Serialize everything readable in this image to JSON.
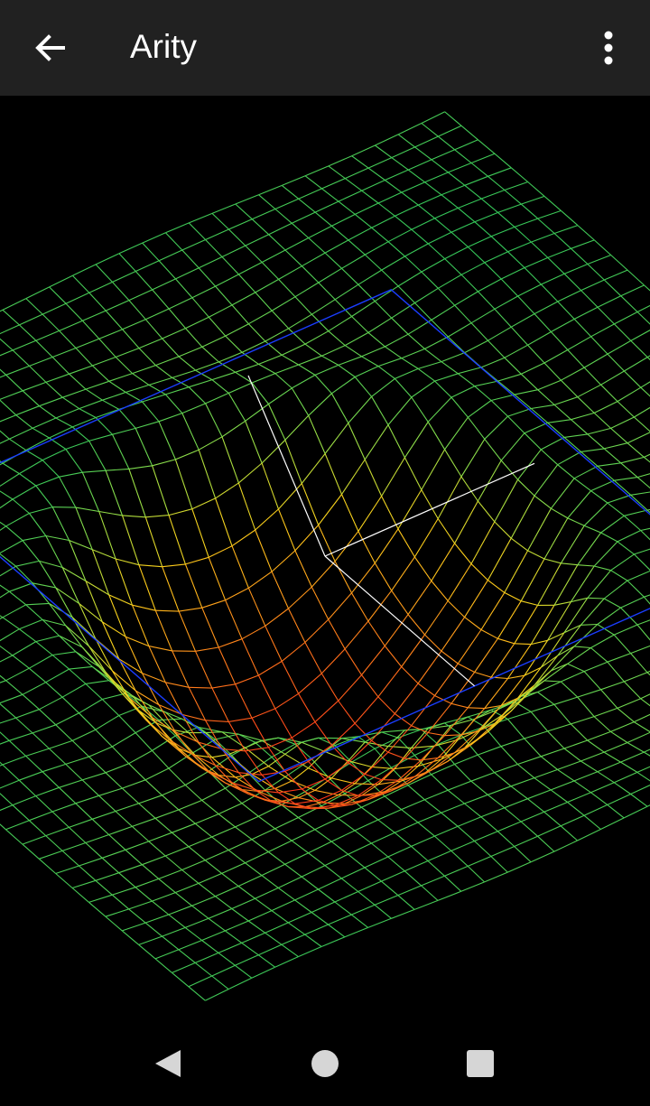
{
  "app": {
    "title": "Arity"
  },
  "toolbar": {
    "back_icon": "arrow-left-icon",
    "overflow_icon": "more-vert-icon"
  },
  "graph": {
    "type": "3d-surface-wireframe",
    "colors": {
      "low": "#ff2a1a",
      "mid": "#ffd21a",
      "high": "#2ec45a",
      "rim": "#1a3dff",
      "axis": "#ffffff",
      "background": "#000000"
    }
  },
  "navigation": {
    "back_icon": "triangle-back-icon",
    "home_icon": "circle-home-icon",
    "recents_icon": "square-recents-icon",
    "color": "#d6d6d6"
  }
}
